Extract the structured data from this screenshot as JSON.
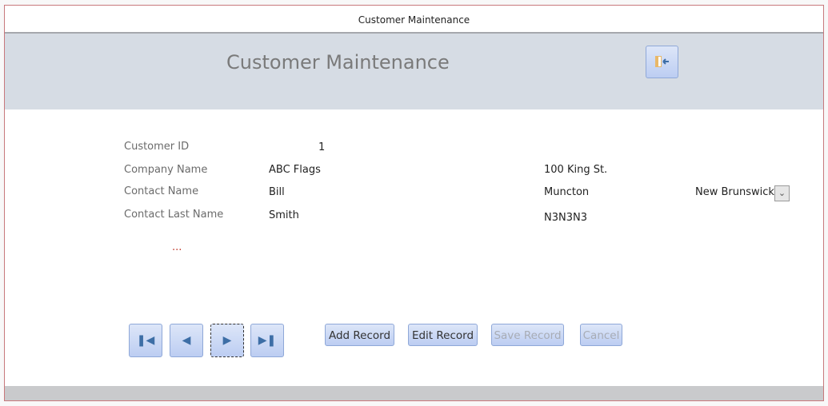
{
  "window": {
    "title": "Customer Maintenance"
  },
  "header": {
    "title": "Customer Maintenance",
    "exit_icon": "exit-door-icon"
  },
  "form": {
    "customer_id_label": "Customer ID",
    "customer_id": "1",
    "company_label": "Company Name",
    "company": "ABC Flags",
    "contact_label": "Contact Name",
    "contact": "Bill",
    "last_label": "Contact Last Name",
    "last": "Smith",
    "address": "100 King St.",
    "city": "Muncton",
    "province": "New Brunswick",
    "postal": "N3N3N3",
    "ellipsis": "..."
  },
  "nav": {
    "first": "first-record-icon",
    "prev": "previous-record-icon",
    "next": "next-record-icon",
    "last": "last-record-icon"
  },
  "buttons": {
    "add": "Add Record",
    "edit": "Edit Record",
    "save": "Save Record",
    "cancel": "Cancel"
  }
}
